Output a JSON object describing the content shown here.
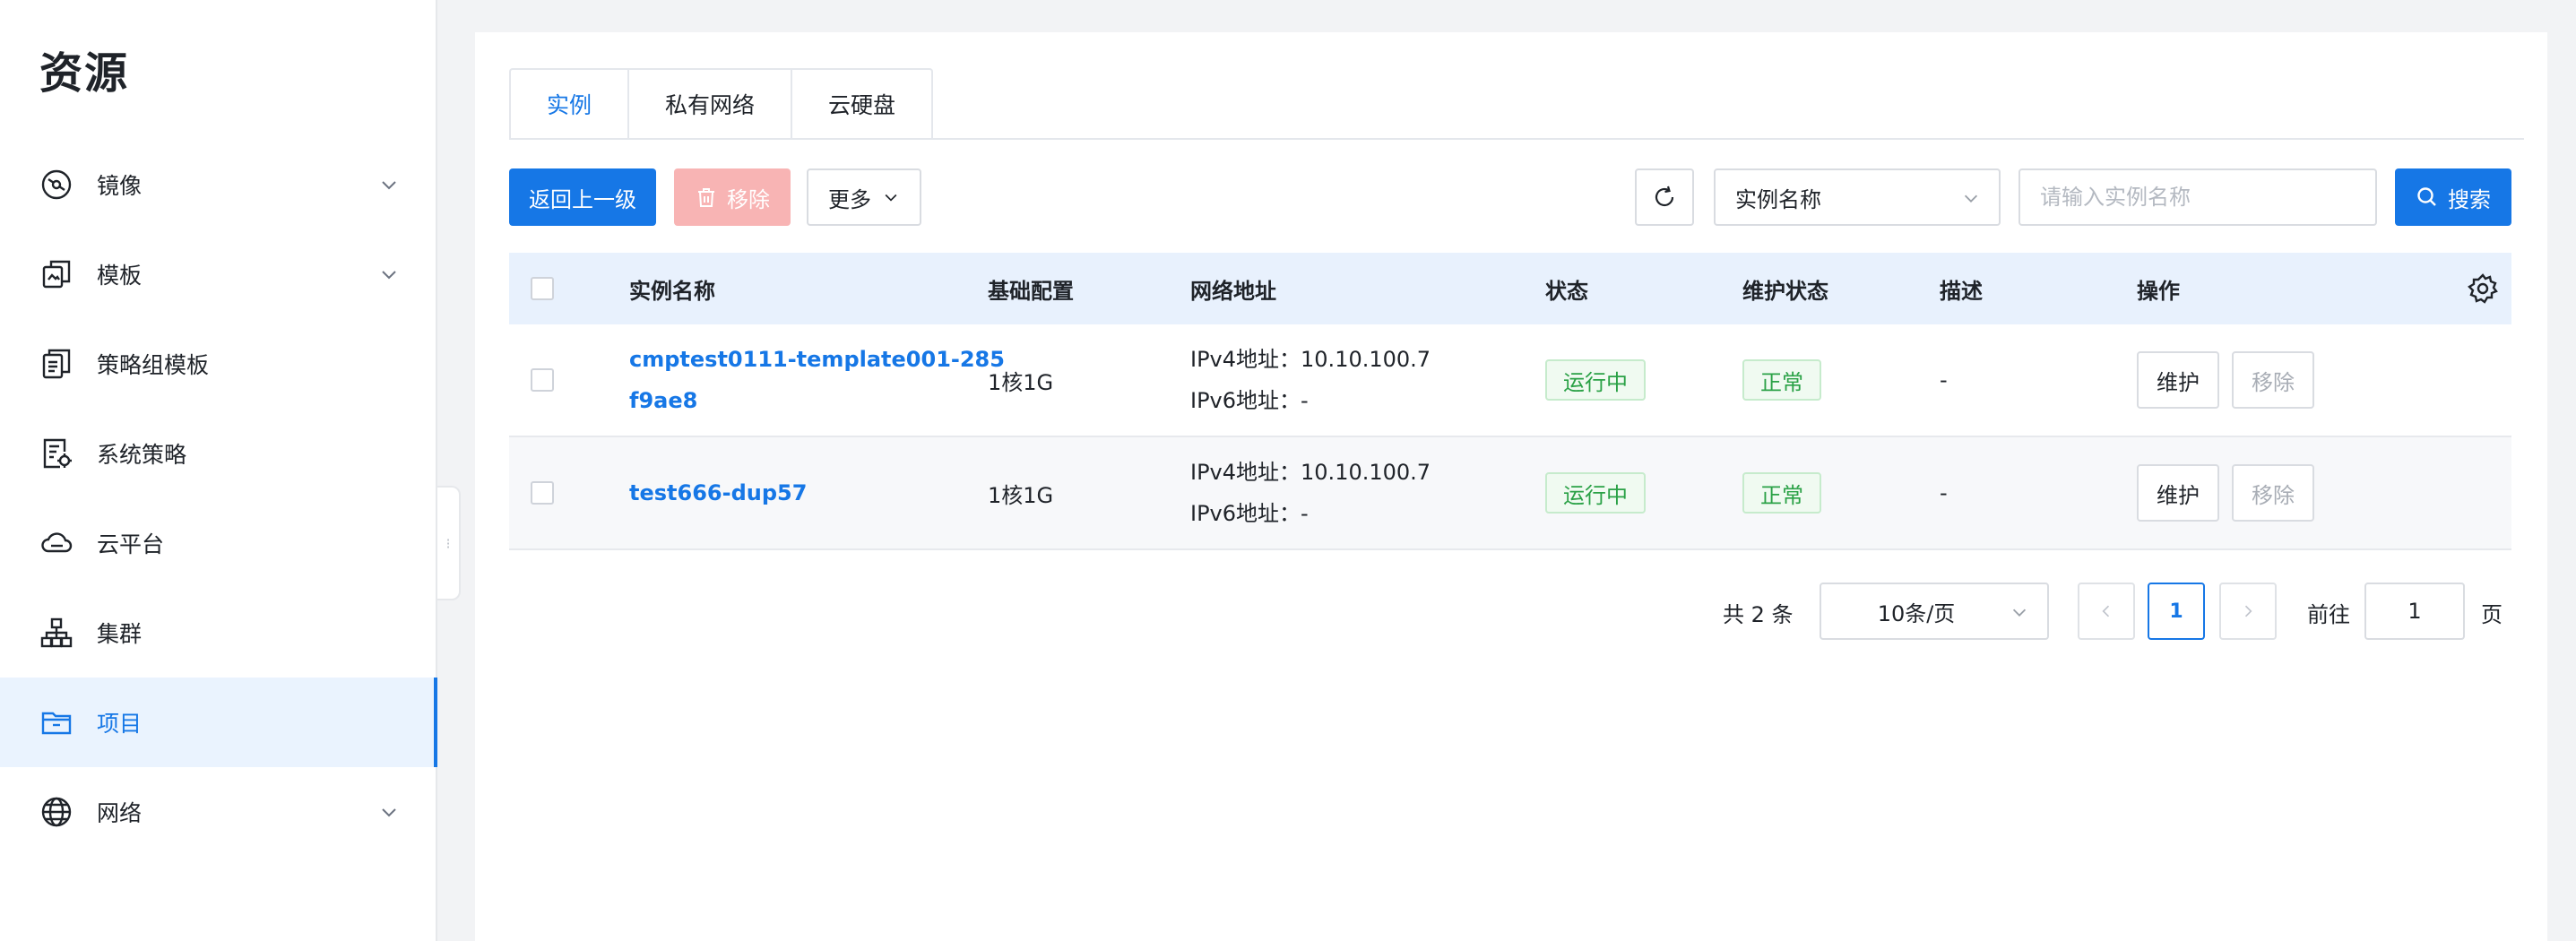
{
  "sidebar": {
    "title": "资源",
    "items": [
      {
        "label": "镜像",
        "icon": "image-disc-icon",
        "has_children": true,
        "active": false
      },
      {
        "label": "模板",
        "icon": "template-icon",
        "has_children": true,
        "active": false
      },
      {
        "label": "策略组模板",
        "icon": "policy-group-template-icon",
        "has_children": false,
        "active": false
      },
      {
        "label": "系统策略",
        "icon": "system-policy-icon",
        "has_children": false,
        "active": false
      },
      {
        "label": "云平台",
        "icon": "cloud-icon",
        "has_children": false,
        "active": false
      },
      {
        "label": "集群",
        "icon": "cluster-icon",
        "has_children": false,
        "active": false
      },
      {
        "label": "项目",
        "icon": "folder-icon",
        "has_children": false,
        "active": true
      },
      {
        "label": "网络",
        "icon": "globe-icon",
        "has_children": true,
        "active": false
      }
    ]
  },
  "tabs": [
    {
      "label": "实例",
      "active": true
    },
    {
      "label": "私有网络",
      "active": false
    },
    {
      "label": "云硬盘",
      "active": false
    }
  ],
  "toolbar": {
    "back_label": "返回上一级",
    "remove_label": "移除",
    "more_label": "更多",
    "search_field_label": "实例名称",
    "search_placeholder": "请输入实例名称",
    "search_label": "搜索"
  },
  "table": {
    "columns": [
      "实例名称",
      "基础配置",
      "网络地址",
      "状态",
      "维护状态",
      "描述",
      "操作"
    ],
    "rows": [
      {
        "name_line1": "cmptest0111-template001-285",
        "name_line2": "f9ae8",
        "config": "1核1G",
        "ipv4": "IPv4地址：10.10.100.7",
        "ipv6": "IPv6地址：-",
        "status": "运行中",
        "maintenance": "正常",
        "description": "-",
        "action_maintain": "维护",
        "action_remove": "移除"
      },
      {
        "name_line1": "test666-dup57",
        "name_line2": "",
        "config": "1核1G",
        "ipv4": "IPv4地址：10.10.100.7",
        "ipv6": "IPv6地址：-",
        "status": "运行中",
        "maintenance": "正常",
        "description": "-",
        "action_maintain": "维护",
        "action_remove": "移除"
      }
    ]
  },
  "pagination": {
    "total_text": "共 2 条",
    "page_size": "10条/页",
    "current_page": "1",
    "goto_label": "前往",
    "goto_value": "1",
    "page_unit": "页"
  },
  "colors": {
    "accent": "#1677e6",
    "success": "#2aa146",
    "danger_disabled": "#f8b4b4"
  }
}
